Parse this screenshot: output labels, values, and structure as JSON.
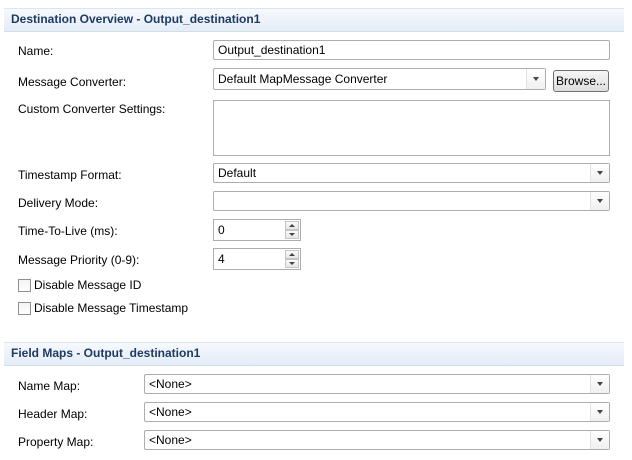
{
  "overview": {
    "title": "Destination Overview - Output_destination1",
    "name_label": "Name:",
    "name_value": "Output_destination1",
    "converter_label": "Message Converter:",
    "converter_value": "Default MapMessage Converter",
    "browse_label": "Browse...",
    "custom_settings_label": "Custom Converter Settings:",
    "custom_settings_value": "",
    "timestamp_label": "Timestamp Format:",
    "timestamp_value": "Default",
    "delivery_label": "Delivery Mode:",
    "delivery_value": "",
    "ttl_label": "Time-To-Live (ms):",
    "ttl_value": "0",
    "priority_label": "Message Priority (0-9):",
    "priority_value": "4",
    "disable_id_label": "Disable Message ID",
    "disable_id_checked": false,
    "disable_ts_label": "Disable Message Timestamp",
    "disable_ts_checked": false
  },
  "field_maps": {
    "title": "Field Maps - Output_destination1",
    "name_map_label": "Name Map:",
    "name_map_value": "<None>",
    "header_map_label": "Header Map:",
    "header_map_value": "<None>",
    "property_map_label": "Property Map:",
    "property_map_value": "<None>"
  }
}
